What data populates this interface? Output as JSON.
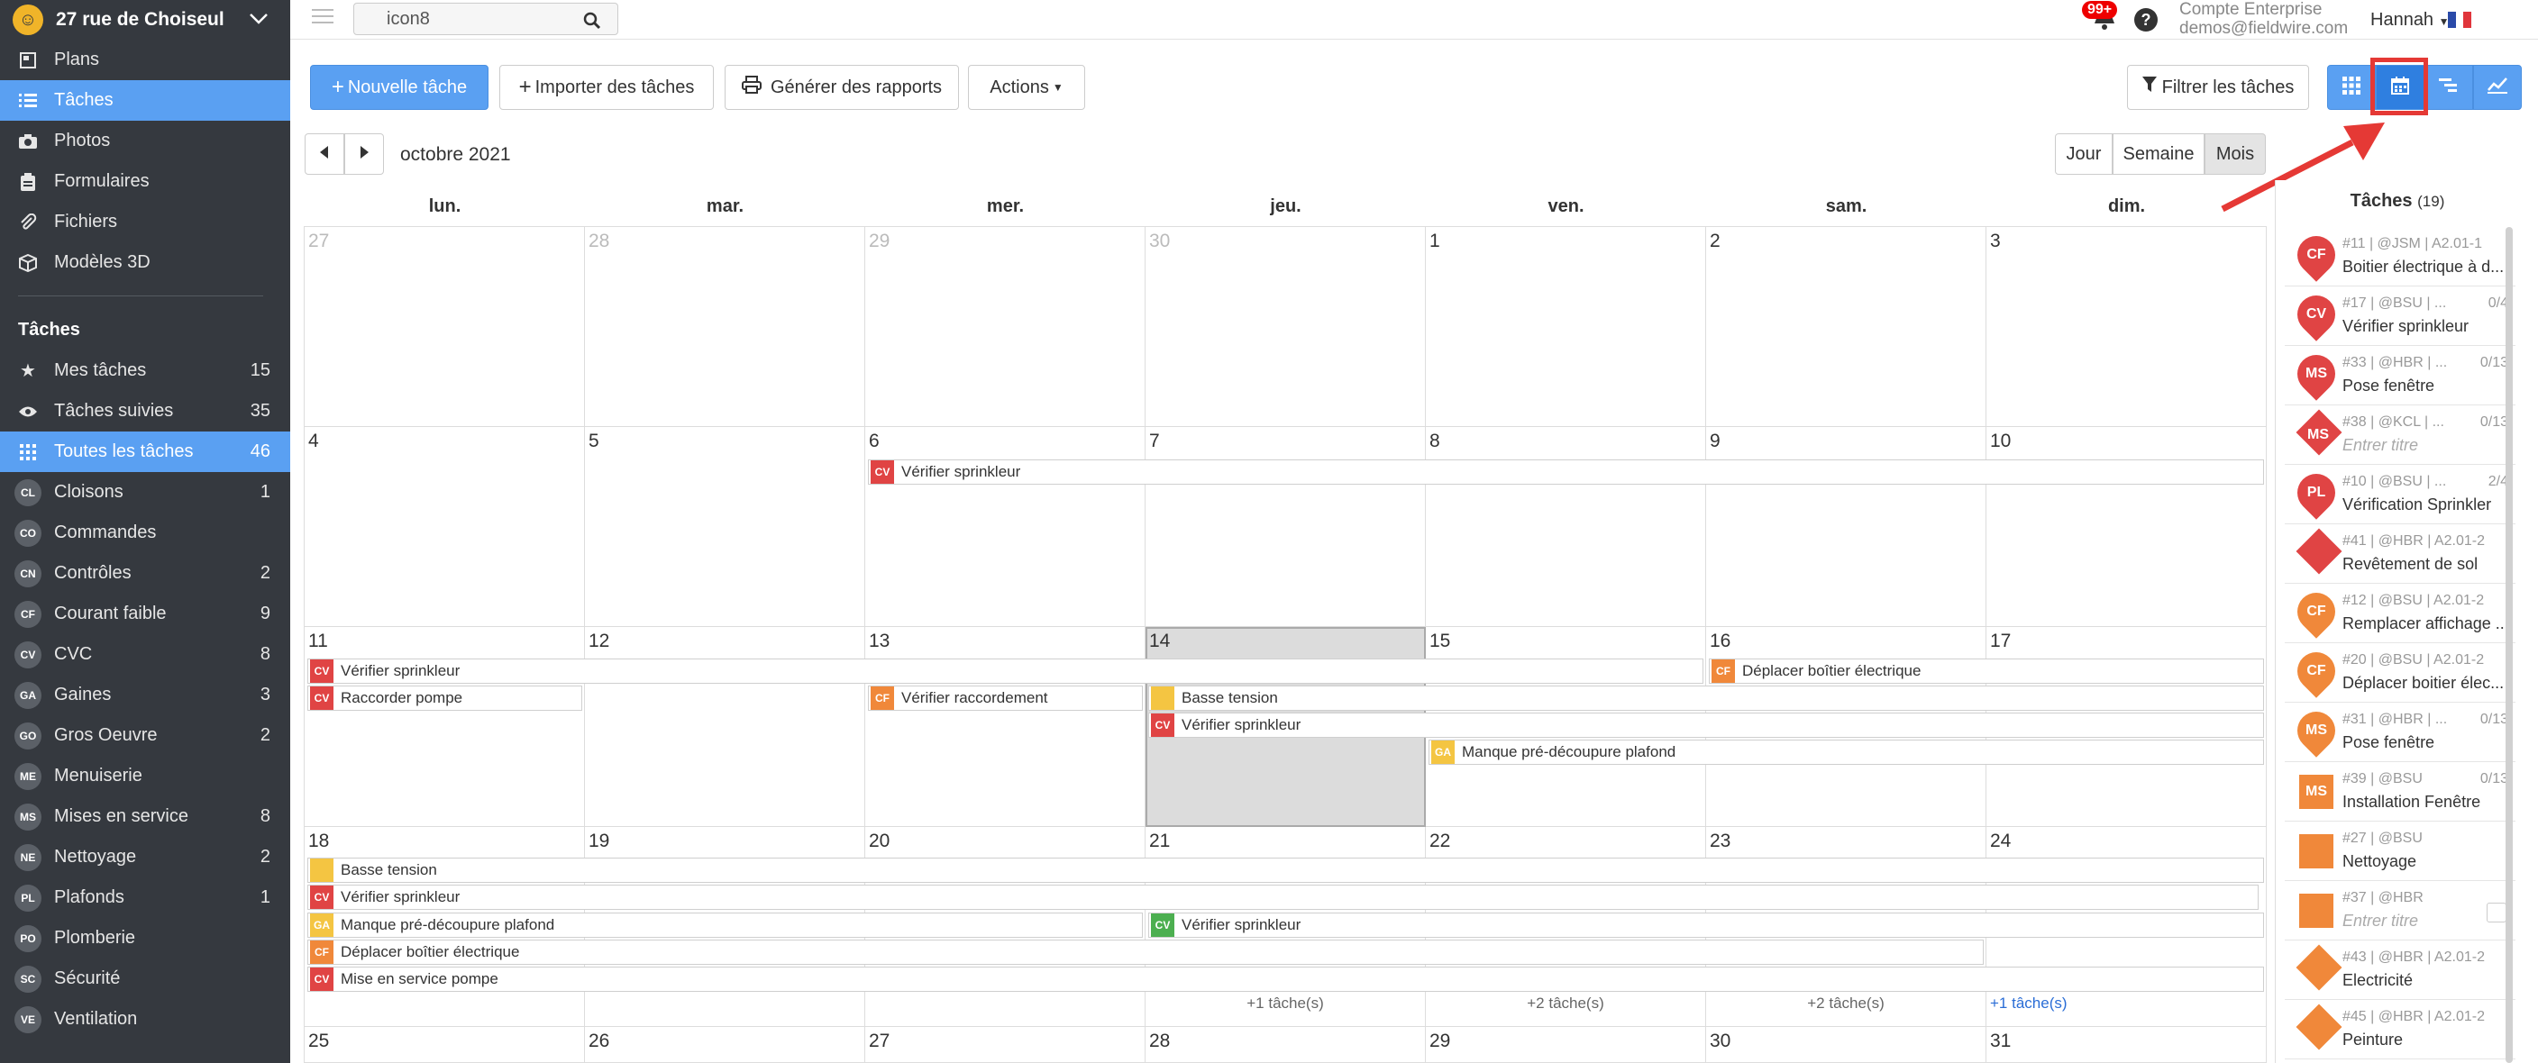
{
  "colors": {
    "accent": "#5aa0f2",
    "sidebar": "#35393f",
    "cv": "#e04444",
    "cf": "#f0883a",
    "ga": "#f4c542",
    "ms": "#f0883a"
  },
  "project": {
    "name": "27 rue de Choiseul"
  },
  "nav": [
    {
      "label": "Plans",
      "icon": "plans-icon"
    },
    {
      "label": "Tâches",
      "icon": "list-icon"
    },
    {
      "label": "Photos",
      "icon": "camera-icon"
    },
    {
      "label": "Formulaires",
      "icon": "clipboard-icon"
    },
    {
      "label": "Fichiers",
      "icon": "paperclip-icon"
    },
    {
      "label": "Modèles 3D",
      "icon": "cube-icon"
    }
  ],
  "tasks_section": {
    "title": "Tâches",
    "items": [
      {
        "label": "Mes tâches",
        "count": "15"
      },
      {
        "label": "Tâches suivies",
        "count": "35"
      },
      {
        "label": "Toutes les tâches",
        "count": "46"
      }
    ],
    "categories": [
      {
        "abbr": "CL",
        "label": "Cloisons",
        "count": "1"
      },
      {
        "abbr": "CO",
        "label": "Commandes",
        "count": ""
      },
      {
        "abbr": "CN",
        "label": "Contrôles",
        "count": "2"
      },
      {
        "abbr": "CF",
        "label": "Courant faible",
        "count": "9"
      },
      {
        "abbr": "CV",
        "label": "CVC",
        "count": "8"
      },
      {
        "abbr": "GA",
        "label": "Gaines",
        "count": "3"
      },
      {
        "abbr": "GO",
        "label": "Gros Oeuvre",
        "count": "2"
      },
      {
        "abbr": "ME",
        "label": "Menuiserie",
        "count": ""
      },
      {
        "abbr": "MS",
        "label": "Mises en service",
        "count": "8"
      },
      {
        "abbr": "NE",
        "label": "Nettoyage",
        "count": "2"
      },
      {
        "abbr": "PL",
        "label": "Plafonds",
        "count": "1"
      },
      {
        "abbr": "PO",
        "label": "Plomberie",
        "count": ""
      },
      {
        "abbr": "SC",
        "label": "Sécurité",
        "count": ""
      },
      {
        "abbr": "VE",
        "label": "Ventilation",
        "count": ""
      }
    ]
  },
  "topbar": {
    "search_value": "icon8",
    "badge": "99+",
    "help": "?",
    "account_type": "Compte Enterprise",
    "account_email": "demos@fieldwire.com",
    "user": "Hannah"
  },
  "toolbar": {
    "new_task": "Nouvelle tâche",
    "import": "Importer des tâches",
    "reports": "Générer des rapports",
    "actions": "Actions",
    "filter": "Filtrer les tâches"
  },
  "calendar": {
    "month_label": "octobre 2021",
    "views": [
      "Jour",
      "Semaine",
      "Mois"
    ],
    "weekdays": [
      "lun.",
      "mar.",
      "mer.",
      "jeu.",
      "ven.",
      "sam.",
      "dim."
    ],
    "weeks": [
      [
        "27",
        "28",
        "29",
        "30",
        "1",
        "2",
        "3"
      ],
      [
        "4",
        "5",
        "6",
        "7",
        "8",
        "9",
        "10"
      ],
      [
        "11",
        "12",
        "13",
        "14",
        "15",
        "16",
        "17"
      ],
      [
        "18",
        "19",
        "20",
        "21",
        "22",
        "23",
        "24"
      ],
      [
        "25",
        "26",
        "27",
        "28",
        "29",
        "30",
        "31"
      ]
    ],
    "events": [
      {
        "tag": "CV",
        "label": "Vérifier sprinkleur"
      },
      {
        "tag": "CV",
        "label": "Vérifier sprinkleur"
      },
      {
        "tag": "CF",
        "label": "Déplacer boîtier électrique"
      },
      {
        "tag": "CV",
        "label": "Raccorder pompe"
      },
      {
        "tag": "CF",
        "label": "Vérifier raccordement"
      },
      {
        "tag": "",
        "label": "Basse tension"
      },
      {
        "tag": "CV",
        "label": "Vérifier sprinkleur"
      },
      {
        "tag": "GA",
        "label": "Manque pré-découpure plafond"
      },
      {
        "tag": "",
        "label": "Basse tension"
      },
      {
        "tag": "CV",
        "label": "Vérifier sprinkleur"
      },
      {
        "tag": "GA",
        "label": "Manque pré-découpure plafond"
      },
      {
        "tag": "CV",
        "label": "Vérifier sprinkleur"
      },
      {
        "tag": "CF",
        "label": "Déplacer boîtier électrique"
      },
      {
        "tag": "CV",
        "label": "Mise en service pompe"
      }
    ],
    "more": [
      "+1 tâche(s)",
      "+2 tâche(s)",
      "+2 tâche(s)",
      "+1 tâche(s)"
    ]
  },
  "panel": {
    "title": "Tâches",
    "count": "(19)",
    "items": [
      {
        "tag": "CF",
        "meta": "#11 | @JSM | A2.01-1",
        "prog": "",
        "name": "Boitier électrique à d..."
      },
      {
        "tag": "CV",
        "meta": "#17 | @BSU | ...",
        "prog": "0/4",
        "name": "Vérifier sprinkleur"
      },
      {
        "tag": "MS",
        "meta": "#33 | @HBR | ...",
        "prog": "0/13",
        "name": "Pose fenêtre"
      },
      {
        "tag": "MS",
        "meta": "#38 | @KCL | ...",
        "prog": "0/13",
        "name": "Entrer titre"
      },
      {
        "tag": "PL",
        "meta": "#10 | @BSU | ...",
        "prog": "2/4",
        "name": "Vérification Sprinkler"
      },
      {
        "tag": "",
        "meta": "#41 | @HBR | A2.01-2",
        "prog": "",
        "name": "Revêtement de sol"
      },
      {
        "tag": "CF",
        "meta": "#12 | @BSU | A2.01-2",
        "prog": "",
        "name": "Remplacer affichage ..."
      },
      {
        "tag": "CF",
        "meta": "#20 | @BSU | A2.01-2",
        "prog": "",
        "name": "Déplacer boitier élec..."
      },
      {
        "tag": "MS",
        "meta": "#31 | @HBR | ...",
        "prog": "0/13",
        "name": "Pose fenêtre"
      },
      {
        "tag": "MS",
        "meta": "#39 | @BSU",
        "prog": "0/13",
        "name": "Installation Fenêtre"
      },
      {
        "tag": "",
        "meta": "#27 | @BSU",
        "prog": "",
        "name": "Nettoyage"
      },
      {
        "tag": "",
        "meta": "#37 | @HBR",
        "prog": "",
        "name": "Entrer titre"
      },
      {
        "tag": "",
        "meta": "#43 | @HBR | A2.01-2",
        "prog": "",
        "name": "Electricité"
      },
      {
        "tag": "",
        "meta": "#45 | @HBR | A2.01-2",
        "prog": "",
        "name": "Peinture"
      }
    ]
  }
}
